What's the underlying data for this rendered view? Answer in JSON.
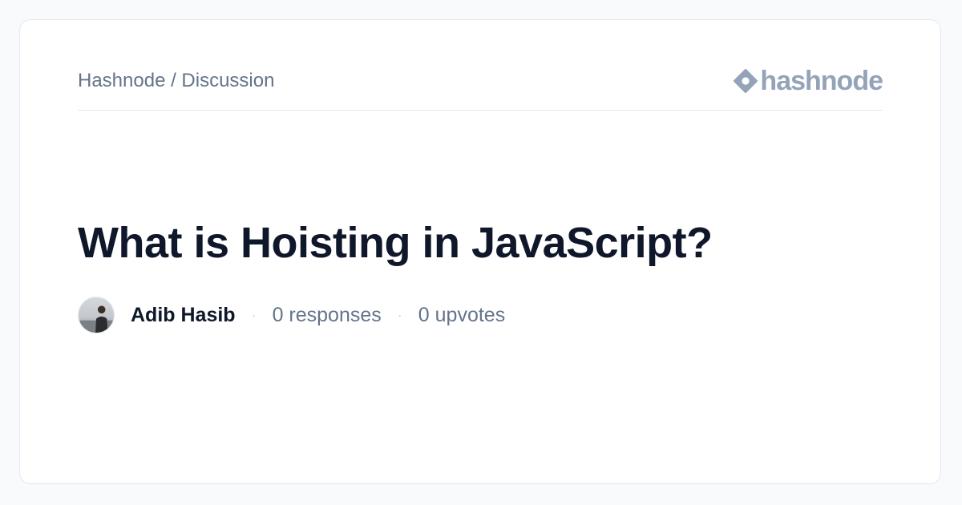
{
  "header": {
    "breadcrumb": "Hashnode / Discussion",
    "logo_text": "hashnode",
    "logo_icon": "hashnode-diamond-icon"
  },
  "post": {
    "title": "What is Hoisting in JavaScript?",
    "author": "Adib Hasib",
    "responses": "0 responses",
    "upvotes": "0 upvotes",
    "separator": "·"
  },
  "colors": {
    "background": "#f8fafc",
    "card": "#ffffff",
    "title": "#0f172a",
    "muted": "#64748b",
    "logo": "#94a3b8",
    "border": "#e2e8f0"
  }
}
